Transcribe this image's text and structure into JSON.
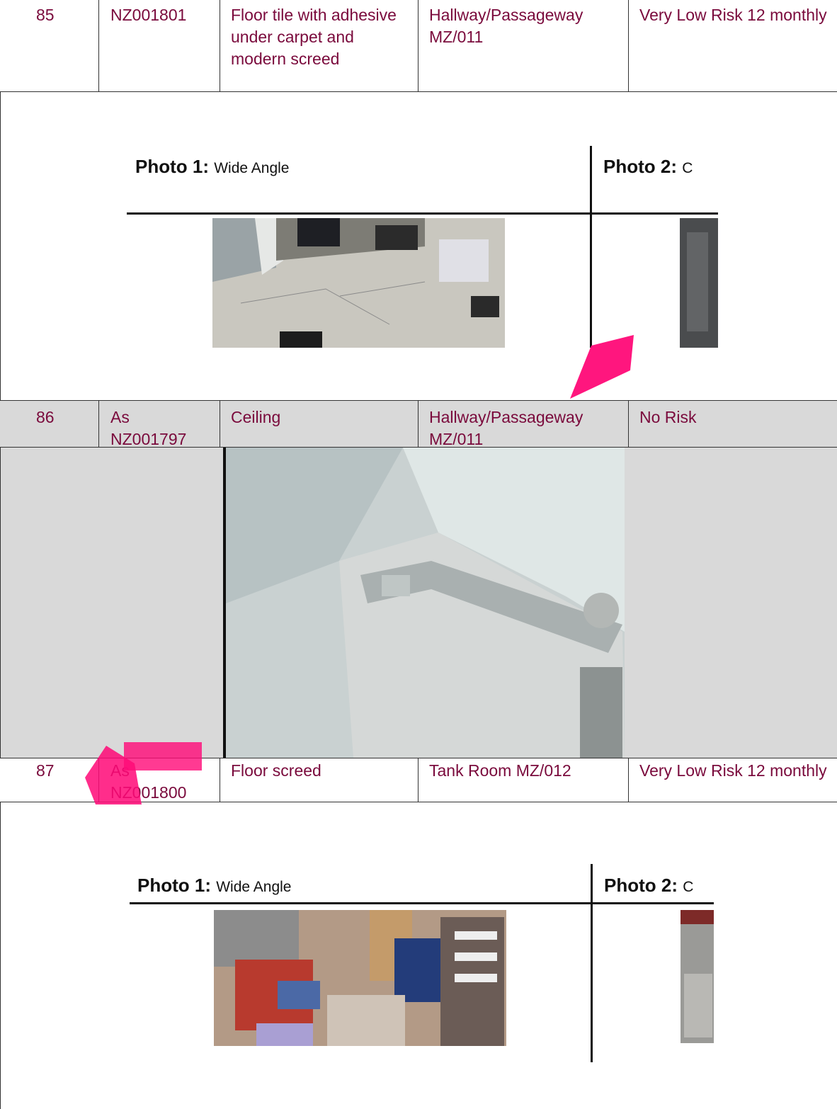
{
  "rows": [
    {
      "no": "85",
      "ref": "NZ001801",
      "description": "Floor tile with adhesive under carpet and modern screed",
      "location": "Hallway/Passageway MZ/011",
      "risk": "Very Low Risk 12 monthly"
    },
    {
      "no": "86",
      "ref": "As NZ001797",
      "description": "Ceiling",
      "location": "Hallway/Passageway MZ/011",
      "risk": "No Risk"
    },
    {
      "no": "87",
      "ref": "As NZ001800",
      "description": "Floor screed",
      "location": "Tank Room MZ/012",
      "risk": "Very Low Risk 12 monthly"
    }
  ],
  "photo_panels": [
    {
      "photo1_label": "Photo 1:",
      "photo1_caption": "Wide Angle",
      "photo2_label": "Photo 2:",
      "photo2_caption": "C"
    },
    {
      "photo1_label": "Photo 1:",
      "photo1_caption": "Wide Angle",
      "photo2_label": "Photo 2:",
      "photo2_caption": "C"
    }
  ],
  "colors": {
    "text": "#7a0a3c",
    "watermark": "#ff0a78",
    "gray_row": "#d9d9d9"
  }
}
